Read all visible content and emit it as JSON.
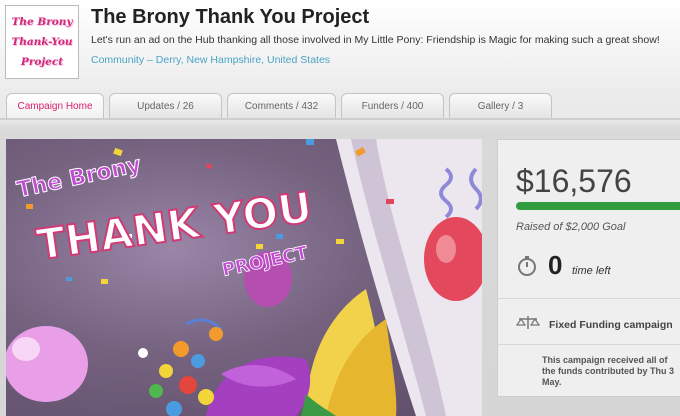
{
  "project": {
    "logo_lines": [
      "The Brony",
      "Thank-You",
      "Project"
    ],
    "title": "The Brony Thank You Project",
    "tagline": "Let's run an ad on the Hub thanking all those involved in My Little Pony: Friendship is Magic for making such a great show!",
    "location": "Community – Derry, New Hampshire, United States"
  },
  "tabs": [
    {
      "label": "Campaign Home",
      "active": true
    },
    {
      "label": "Updates / 26",
      "active": false
    },
    {
      "label": "Comments / 432",
      "active": false
    },
    {
      "label": "Funders / 400",
      "active": false
    },
    {
      "label": "Gallery / 3",
      "active": false
    }
  ],
  "hero": {
    "line1": "The Brony",
    "line2": "THANK YOU",
    "line3": "PROJECT"
  },
  "campaign": {
    "amount": "$16,576",
    "progress_fraction": 1.0,
    "goal_text": "Raised of $2,000 Goal",
    "time_left_value": "0",
    "time_left_label": "time left",
    "funding_type": "Fixed Funding campaign",
    "note_lines": [
      "This campaign received all of",
      "the funds contributed by Thu 3",
      "May."
    ]
  },
  "icons": {
    "timer": "stopwatch-icon",
    "funding": "scale-icon"
  },
  "colors": {
    "active_tab": "#d81f6e",
    "location_link": "#4aa3c6",
    "progress": "#2f9c3d",
    "logo_text": "#d1287a"
  }
}
